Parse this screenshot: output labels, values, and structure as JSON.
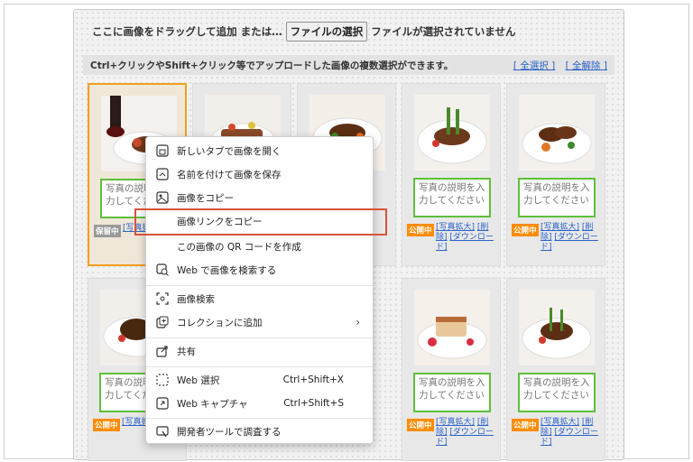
{
  "upload": {
    "drag_text": "ここに画像をドラッグして追加",
    "or_text": "または…",
    "file_button": "ファイルの選択",
    "no_file": "ファイルが選択されていません"
  },
  "toolbar": {
    "description": "Ctrl+クリックやShift+クリック等でアップロードした画像の複数選択ができます。",
    "select_all": "[ 全選択 ]",
    "deselect_all": "[ 全解除 ]"
  },
  "card": {
    "caption_placeholder": "写真の説明を入力してください",
    "status_public": "公開中",
    "status_private": "保留中",
    "zoom": "[写真拡大]",
    "delete": "[削除]",
    "download": "[ダウンロード]"
  },
  "context_menu": {
    "items": [
      {
        "label": "新しいタブで画像を開く",
        "icon": "new-tab-icon"
      },
      {
        "label": "名前を付けて画像を保存",
        "icon": "save-image-icon"
      },
      {
        "label": "画像をコピー",
        "icon": "copy-image-icon"
      },
      {
        "label": "画像リンクをコピー",
        "icon": ""
      },
      {
        "label": "この画像の QR コードを作成",
        "icon": ""
      },
      {
        "label": "Web で画像を検索する",
        "icon": "image-search-icon"
      },
      {
        "label": "画像検索",
        "icon": "visual-search-icon"
      },
      {
        "label": "コレクションに追加",
        "icon": "collections-icon"
      },
      {
        "label": "共有",
        "icon": "share-icon"
      },
      {
        "label": "Web 選択",
        "icon": "web-select-icon",
        "shortcut": "Ctrl+Shift+X"
      },
      {
        "label": "Web キャプチャ",
        "icon": "web-capture-icon",
        "shortcut": "Ctrl+Shift+S"
      },
      {
        "label": "開発者ツールで調査する",
        "icon": "devtools-icon"
      }
    ],
    "submenu_arrow": "›"
  },
  "colors": {
    "accent_link": "#2a62c9",
    "status_public": "#ff8c00",
    "selected_border": "#f0a020",
    "caption_border": "#5fbf3a",
    "highlight_box": "#d9533a"
  }
}
